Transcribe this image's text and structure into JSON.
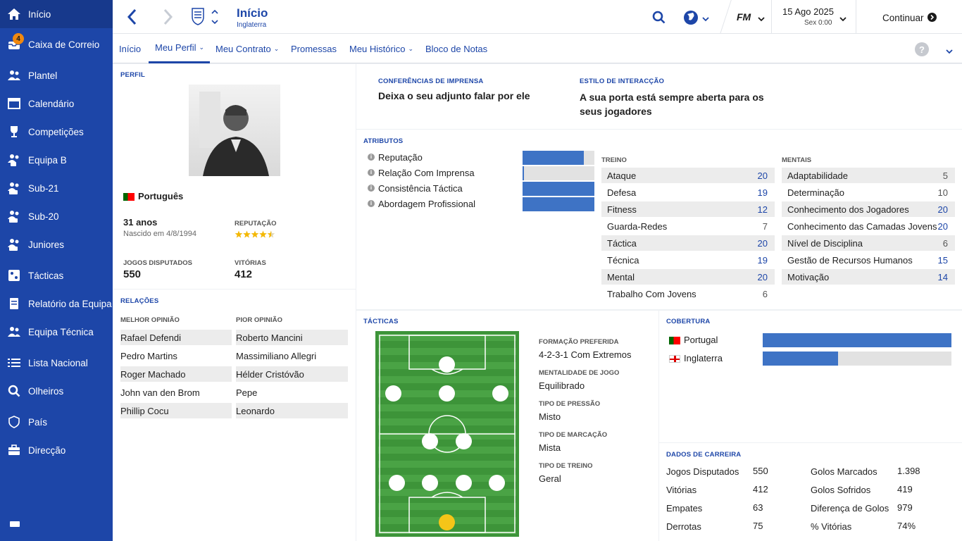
{
  "sidebar": {
    "items": [
      {
        "label": "Início",
        "icon": "home-icon"
      },
      {
        "label": "Caixa de Correio",
        "icon": "inbox-icon",
        "badge": "4"
      },
      {
        "label": "Plantel",
        "icon": "squad-icon"
      },
      {
        "label": "Calendário",
        "icon": "calendar-icon"
      },
      {
        "label": "Competições",
        "icon": "trophy-icon"
      },
      {
        "label": "Equipa B",
        "icon": "team-b-icon"
      },
      {
        "label": "Sub-21",
        "icon": "u21-icon"
      },
      {
        "label": "Sub-20",
        "icon": "u20-icon"
      },
      {
        "label": "Juniores",
        "icon": "juniors-icon"
      },
      {
        "label": "Tácticas",
        "icon": "tactics-icon"
      },
      {
        "label": "Relatório da Equipa",
        "icon": "report-icon"
      },
      {
        "label": "Equipa Técnica",
        "icon": "staff-icon"
      },
      {
        "label": "Lista Nacional",
        "icon": "list-icon"
      },
      {
        "label": "Olheiros",
        "icon": "search-icon"
      },
      {
        "label": "País",
        "icon": "shield-icon"
      },
      {
        "label": "Direcção",
        "icon": "briefcase-icon"
      }
    ]
  },
  "header": {
    "title": "Início",
    "subtitle": "Inglaterra",
    "date": "15 Ago 2025",
    "time": "Sex 0:00",
    "continue_label": "Continuar",
    "fm_logo": "FM"
  },
  "tabs": [
    {
      "label": "Início"
    },
    {
      "label": "Meu Perfil",
      "chevron": "⌄"
    },
    {
      "label": "Meu Contrato",
      "chevron": "⌄"
    },
    {
      "label": "Promessas"
    },
    {
      "label": "Meu Histórico",
      "chevron": "⌄"
    },
    {
      "label": "Bloco de Notas"
    }
  ],
  "profile": {
    "section": "PERFIL",
    "nationality": "Português",
    "age": "31 anos",
    "born": "Nascido em 4/8/1994",
    "reputation_label": "REPUTAÇÃO",
    "reputation_stars": 4.5,
    "games_label": "JOGOS DISPUTADOS",
    "games": "550",
    "wins_label": "VITÓRIAS",
    "wins": "412"
  },
  "relations": {
    "section": "RELAÇÕES",
    "best_label": "MELHOR OPINIÃO",
    "worst_label": "PIOR OPINIÃO",
    "best": [
      "Rafael Defendi",
      "Pedro Martins",
      "Roger Machado",
      "John van den Brom",
      "Phillip Cocu"
    ],
    "worst": [
      "Roberto Mancini",
      "Massimiliano Allegri",
      "Hélder Cristóvão",
      "Pepe",
      "Leonardo"
    ]
  },
  "press": {
    "label": "CONFERÊNCIAS DE IMPRENSA",
    "value": "Deixa o seu adjunto falar por ele",
    "style_label": "ESTILO DE INTERACÇÃO",
    "style_value": "A sua porta está sempre aberta para os seus jogadores"
  },
  "attributes": {
    "section": "ATRIBUTOS",
    "bars": [
      {
        "label": "Reputação",
        "fraction": 0.85
      },
      {
        "label": "Relação Com Imprensa",
        "fraction": 0.01
      },
      {
        "label": "Consistência Táctica",
        "fraction": 1.0
      },
      {
        "label": "Abordagem Profissional",
        "fraction": 1.0
      }
    ],
    "training_label": "TREINO",
    "training": [
      {
        "label": "Ataque",
        "value": "20"
      },
      {
        "label": "Defesa",
        "value": "19"
      },
      {
        "label": "Fitness",
        "value": "12"
      },
      {
        "label": "Guarda-Redes",
        "value": "7"
      },
      {
        "label": "Táctica",
        "value": "20"
      },
      {
        "label": "Técnica",
        "value": "19"
      },
      {
        "label": "Mental",
        "value": "20"
      },
      {
        "label": "Trabalho Com Jovens",
        "value": "6"
      }
    ],
    "mental_label": "MENTAIS",
    "mental": [
      {
        "label": "Adaptabilidade",
        "value": "5"
      },
      {
        "label": "Determinação",
        "value": "10"
      },
      {
        "label": "Conhecimento dos Jogadores",
        "value": "20"
      },
      {
        "label": "Conhecimento das Camadas Jovens",
        "value": "20"
      },
      {
        "label": "Nível de Disciplina",
        "value": "6"
      },
      {
        "label": "Gestão de Recursos Humanos",
        "value": "15"
      },
      {
        "label": "Motivação",
        "value": "14"
      }
    ]
  },
  "tactics": {
    "section": "TÁCTICAS",
    "items": [
      {
        "label": "FORMAÇÃO PREFERIDA",
        "value": "4-2-3-1 Com Extremos"
      },
      {
        "label": "MENTALIDADE DE JOGO",
        "value": "Equilibrado"
      },
      {
        "label": "TIPO DE PRESSÃO",
        "value": "Misto"
      },
      {
        "label": "TIPO DE MARCAÇÃO",
        "value": "Mista"
      },
      {
        "label": "TIPO DE TREINO",
        "value": "Geral"
      }
    ]
  },
  "coverage": {
    "section": "COBERTURA",
    "items": [
      {
        "label": "Portugal",
        "fraction": 1.0
      },
      {
        "label": "Inglaterra",
        "fraction": 0.4
      }
    ]
  },
  "career": {
    "section": "DADOS DE CARREIRA",
    "left": [
      {
        "label": "Jogos Disputados",
        "value": "550"
      },
      {
        "label": "Vitórias",
        "value": "412"
      },
      {
        "label": "Empates",
        "value": "63"
      },
      {
        "label": "Derrotas",
        "value": "75"
      }
    ],
    "right": [
      {
        "label": "Golos Marcados",
        "value": "1.398"
      },
      {
        "label": "Golos Sofridos",
        "value": "419"
      },
      {
        "label": "Diferença de Golos",
        "value": "979"
      },
      {
        "label": "% Vitórias",
        "value": "74%"
      }
    ]
  },
  "colors": {
    "accent": "#1d46a8",
    "bar": "#3e73c5",
    "pitch": "#3e9a3a"
  }
}
